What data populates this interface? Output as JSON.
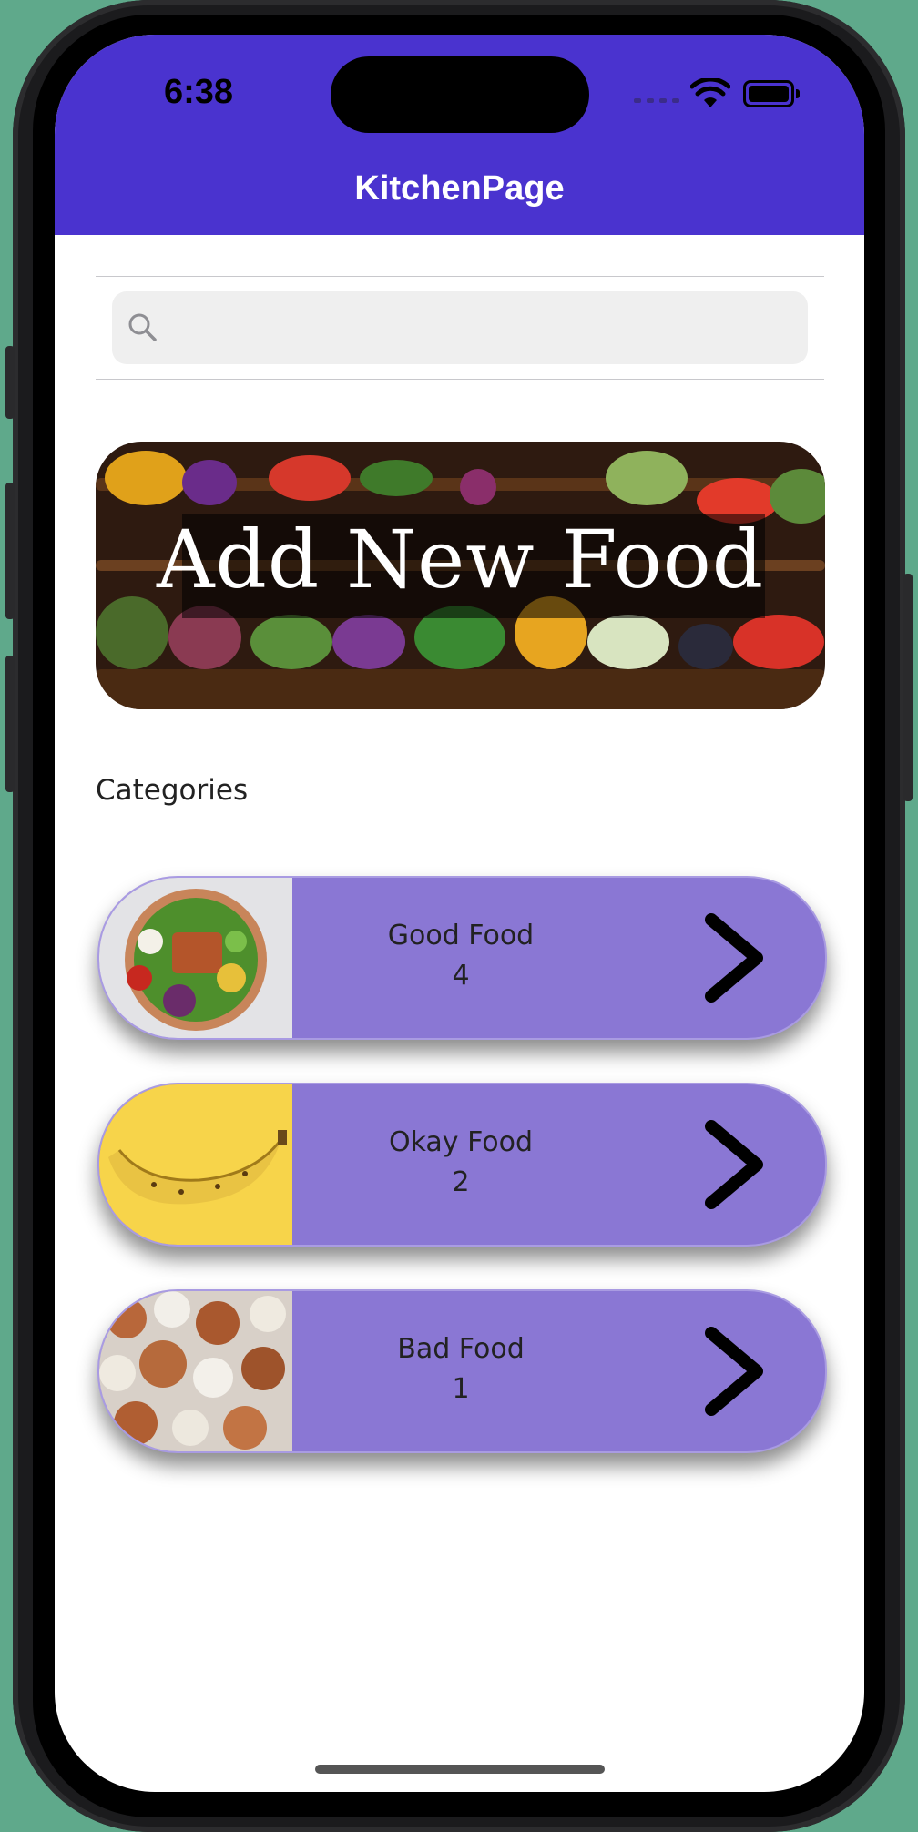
{
  "status_bar": {
    "time": "6:38",
    "icons": [
      "cellular-icon",
      "wifi-icon",
      "battery-icon"
    ]
  },
  "header": {
    "title": "KitchenPage",
    "color": "#4a33cf"
  },
  "search": {
    "placeholder": "",
    "value": "",
    "icon": "search-icon"
  },
  "banner": {
    "label": "Add New Food"
  },
  "categories_section": {
    "label": "Categories"
  },
  "categories": [
    {
      "name": "Good Food",
      "count": "4",
      "thumb": "salad-bowl"
    },
    {
      "name": "Okay Food",
      "count": "2",
      "thumb": "banana"
    },
    {
      "name": "Bad Food",
      "count": "1",
      "thumb": "eggshells"
    }
  ],
  "colors": {
    "card": "#8a77d4",
    "background": "#5fa98b"
  }
}
